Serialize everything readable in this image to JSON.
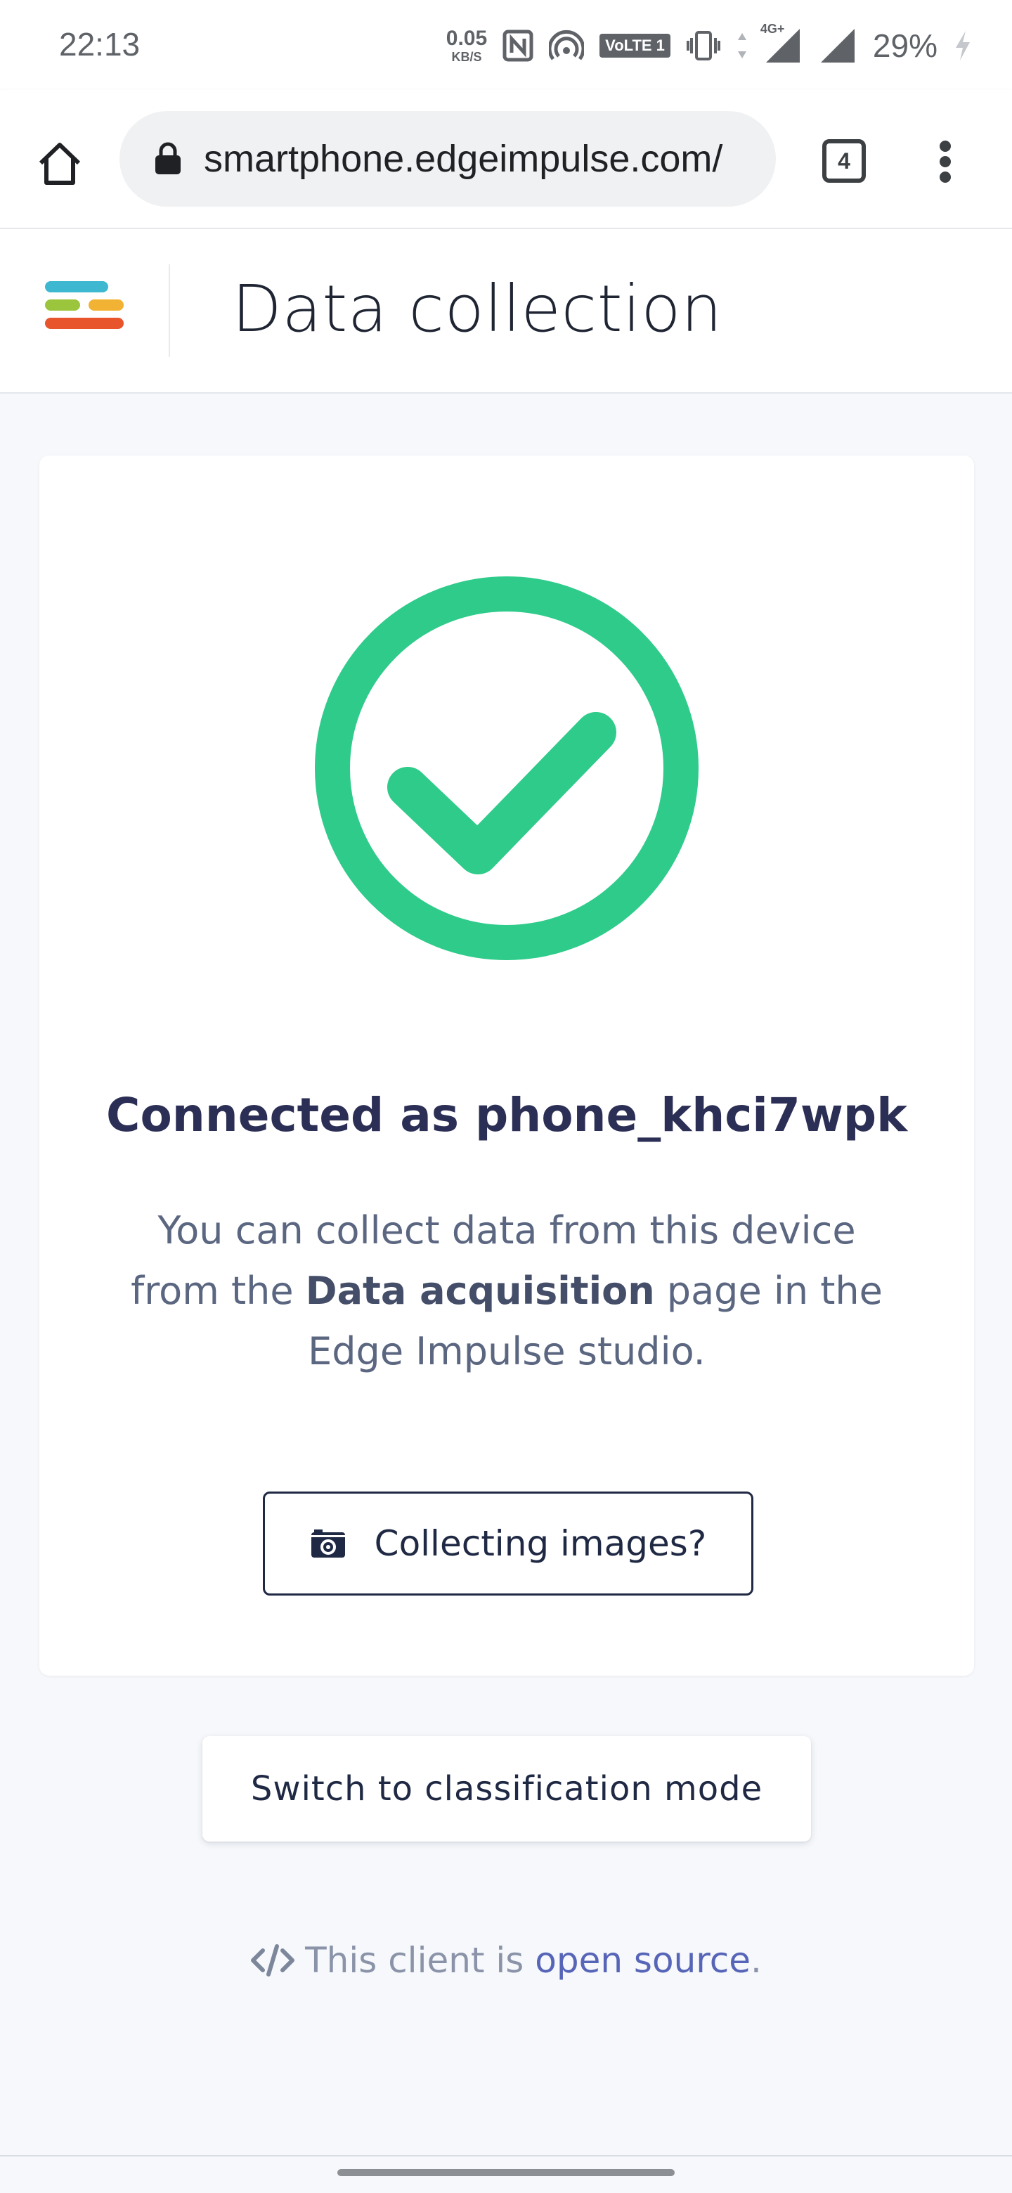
{
  "status_bar": {
    "time": "22:13",
    "net_speed_value": "0.05",
    "net_speed_unit": "KB/S",
    "volte_label": "VoLTE 1",
    "network_label": "4G+",
    "battery_percent": "29%",
    "icons": [
      "nfc-icon",
      "hotspot-icon",
      "vibrate-icon",
      "data-arrows-icon",
      "signal-icon",
      "signal-icon-2",
      "battery-charging-icon"
    ]
  },
  "browser": {
    "url": "smartphone.edgeimpulse.com/",
    "tab_count": "4",
    "icons": [
      "home-icon",
      "lock-icon",
      "tabs-icon",
      "more-vert-icon"
    ]
  },
  "header": {
    "title": "Data collection",
    "logo_colors": [
      "#3eb8d0",
      "#9bc53d",
      "#f2b233",
      "#e8552d"
    ]
  },
  "card": {
    "status_icon": "check-circle-icon",
    "status_color": "#2ecb8a",
    "connected_text": "Connected as phone_khci7wpk",
    "desc_part1": "You can collect data from this device from the ",
    "desc_bold": "Data acquisition",
    "desc_part2": " page in the Edge Impulse studio.",
    "collect_button_label": "Collecting images?",
    "collect_button_icon": "camera-icon"
  },
  "switch_button_label": "Switch to classification mode",
  "footer": {
    "icon": "code-icon",
    "text_before": "This client is ",
    "link_text": "open source",
    "text_after": ".",
    "link_color": "#5765b8"
  }
}
